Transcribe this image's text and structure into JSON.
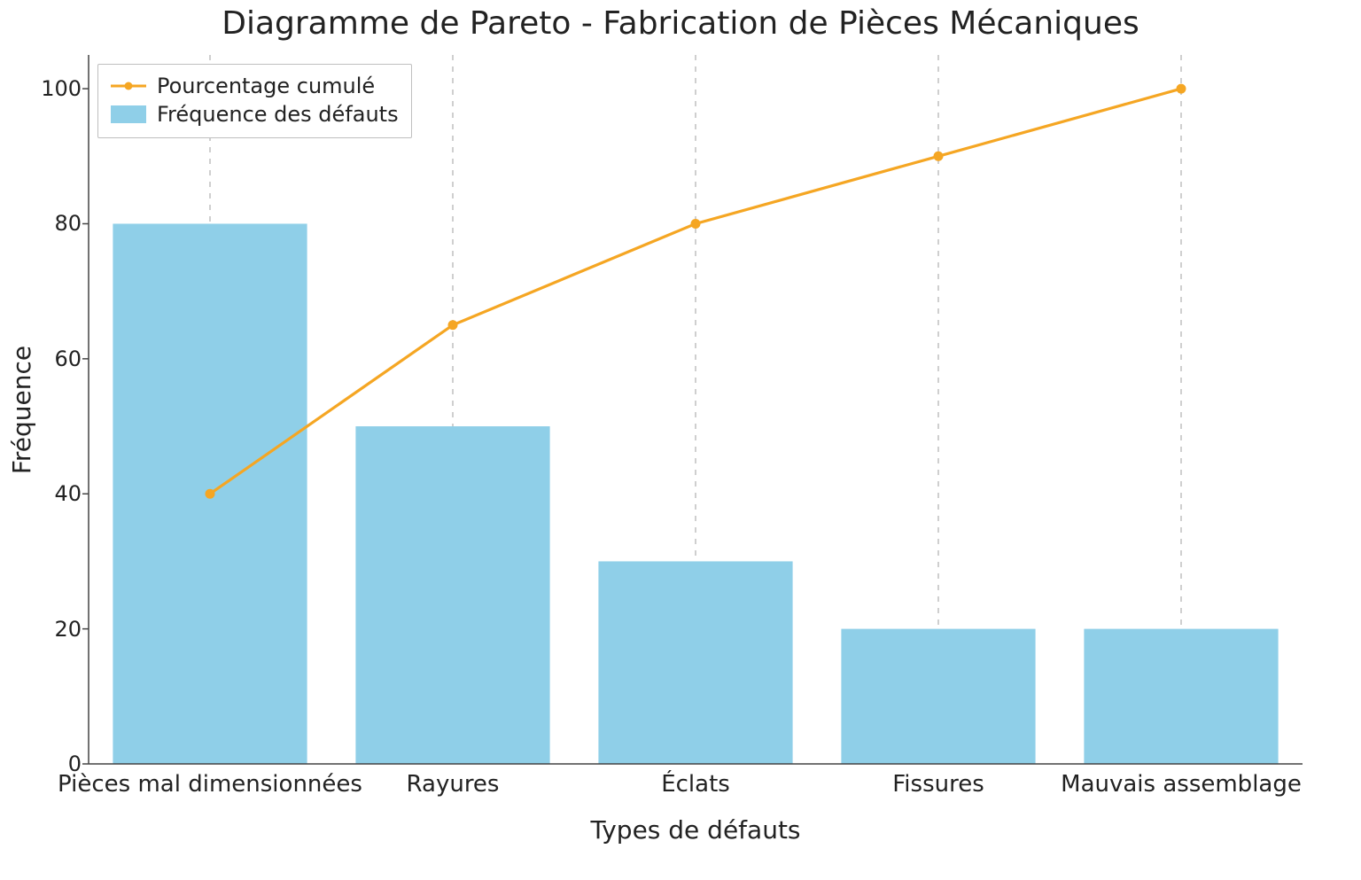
{
  "chart_data": {
    "type": "bar",
    "title": "Diagramme de Pareto - Fabrication de Pièces Mécaniques",
    "xlabel": "Types de défauts",
    "ylabel": "Fréquence",
    "categories": [
      "Pièces mal dimensionnées",
      "Rayures",
      "Éclats",
      "Fissures",
      "Mauvais assemblage"
    ],
    "series": [
      {
        "name": "Fréquence des défauts",
        "values": [
          80,
          50,
          30,
          20,
          20
        ],
        "kind": "bar",
        "color": "#8fcfe8"
      },
      {
        "name": "Pourcentage cumulé",
        "values": [
          40,
          65,
          80,
          90,
          100
        ],
        "kind": "line",
        "color": "#f5a623"
      }
    ],
    "ylim": [
      0,
      105
    ],
    "yticks": [
      0,
      20,
      40,
      60,
      80,
      100
    ],
    "legend_position": "upper-left",
    "grid": {
      "axis": "x",
      "style": "dashed",
      "color": "#bfbfbf"
    }
  }
}
